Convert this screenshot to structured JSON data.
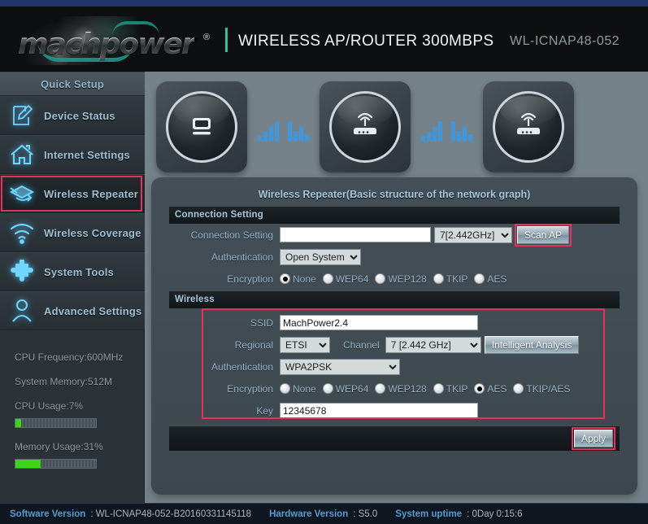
{
  "header": {
    "logo_text": "machpower",
    "logo_registered": "®",
    "title": "WIRELESS AP/ROUTER 300MBPS",
    "model": "WL-ICNAP48-052"
  },
  "sidebar": {
    "items": [
      {
        "label": "Quick Setup",
        "icon": "none",
        "active": false
      },
      {
        "label": "Device Status",
        "icon": "document-edit-icon",
        "active": false
      },
      {
        "label": "Internet Settings",
        "icon": "home-icon",
        "active": false
      },
      {
        "label": "Wireless Repeater",
        "icon": "repeater-icon",
        "active": true
      },
      {
        "label": "Wireless Coverage",
        "icon": "wifi-icon",
        "active": false
      },
      {
        "label": "System Tools",
        "icon": "puzzle-icon",
        "active": false
      },
      {
        "label": "Advanced Settings",
        "icon": "user-icon",
        "active": false
      }
    ],
    "stats": {
      "cpu_frequency": "CPU Frequency:600MHz",
      "system_memory": "System Memory:512M",
      "cpu_usage_label": "CPU Usage:7%",
      "cpu_usage_percent": 7,
      "memory_usage_label": "Memory Usage:31%",
      "memory_usage_percent": 31
    }
  },
  "diagram": {
    "nodes": [
      "computer-icon",
      "router-icon",
      "router-icon"
    ],
    "signal_links": 2
  },
  "panel": {
    "title": "Wireless Repeater(Basic structure of the network graph)",
    "connection_section": {
      "heading": "Connection Setting",
      "connection_label": "Connection Setting",
      "connection_value": "",
      "connection_placeholder": "",
      "channel_selected": "7[2.442GHz]",
      "scan_button": "Scan AP",
      "auth_label": "Authentication",
      "auth_selected": "Open System",
      "encryption_label": "Encryption",
      "encryption_options": [
        "None",
        "WEP64",
        "WEP128",
        "TKIP",
        "AES"
      ],
      "encryption_selected": "None"
    },
    "wireless_section": {
      "heading": "Wireless",
      "ssid_label": "SSID",
      "ssid_value": "MachPower2.4",
      "regional_label": "Regional",
      "regional_selected": "ETSI",
      "channel_label": "Channel",
      "channel_selected": "7 [2.442 GHz]",
      "analysis_button": "Intelligent Analysis",
      "auth_label": "Authentication",
      "auth_selected": "WPA2PSK",
      "encryption_label": "Encryption",
      "encryption_options": [
        "None",
        "WEP64",
        "WEP128",
        "TKIP",
        "AES",
        "TKIP/AES"
      ],
      "encryption_selected": "AES",
      "key_label": "Key",
      "key_value": "12345678"
    },
    "apply_button": "Apply"
  },
  "footer": {
    "software_version_key": "Software Version",
    "software_version_value": ": WL-ICNAP48-052-B20160331145118",
    "hardware_version_key": "Hardware Version",
    "hardware_version_value": ": S5.0",
    "uptime_key": "System uptime",
    "uptime_value": ": 0Day 0:15:6"
  },
  "colors": {
    "accent_blue": "#3f96dd",
    "highlight_red": "#e8305a",
    "label_blue": "#93b1c6",
    "usage_green": "#3bd61b",
    "logo_teal": "#1f9f90"
  }
}
